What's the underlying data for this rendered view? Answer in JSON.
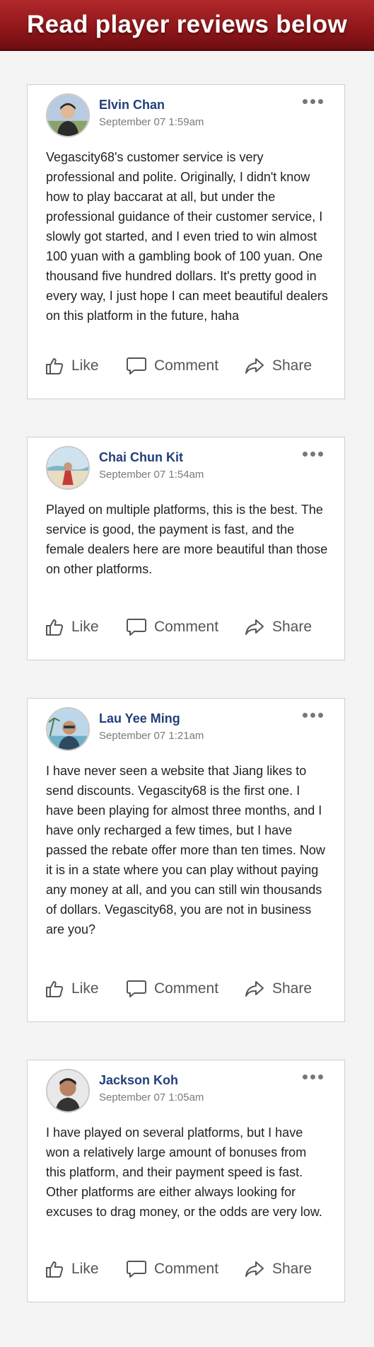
{
  "header": {
    "title": "Read player reviews below"
  },
  "actions": {
    "like": "Like",
    "comment": "Comment",
    "share": "Share"
  },
  "reviews": [
    {
      "name": "Elvin Chan",
      "time": "September 07 1:59am",
      "text": "Vegascity68's customer service is very professional and polite. Originally, I didn't know how to play baccarat at all, but under the professional guidance of their customer service, I slowly got started, and I even tried to win almost 100 yuan with a gambling book of 100 yuan. One thousand five hundred dollars. It's pretty good in every way, I just hope I can meet beautiful dealers on this platform in the future, haha"
    },
    {
      "name": "Chai Chun Kit",
      "time": "September 07 1:54am",
      "text": "Played on multiple platforms, this is the best. The service is good, the payment is fast, and the female dealers here are more beautiful than those on other platforms."
    },
    {
      "name": "Lau Yee Ming",
      "time": "September 07 1:21am",
      "text": "I have never seen a website that Jiang likes to send discounts. Vegascity68 is the first one. I have been playing for almost three months, and I have only recharged a few times, but I have passed the rebate offer more than ten times. Now it is in a state where you can play without paying any money at all, and you can still win thousands of dollars. Vegascity68, you are not in business are you?"
    },
    {
      "name": "Jackson Koh",
      "time": "September 07 1:05am",
      "text": "I have played on several platforms, but I have won a relatively large amount of bonuses from this platform, and their payment speed is fast. Other platforms are either always looking for excuses to drag money, or the odds are very low."
    }
  ],
  "colors": {
    "header": "#9a1c1f",
    "name": "#22407a",
    "text": "#222222",
    "muted": "#7a7a7a"
  }
}
